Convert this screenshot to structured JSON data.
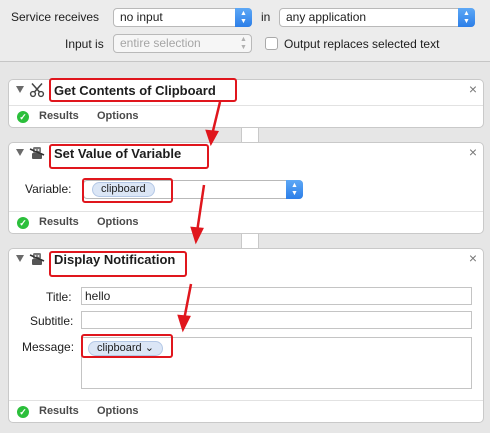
{
  "header": {
    "service_receives_label": "Service receives",
    "service_receives_value": "no input",
    "in_label": "in",
    "application_value": "any application",
    "input_is_label": "Input is",
    "input_is_value": "entire selection",
    "output_replaces_label": "Output replaces selected text",
    "output_replaces_checked": false
  },
  "actions": [
    {
      "title": "Get Contents of Clipboard",
      "icon": "scissors-icon",
      "footer": {
        "results": "Results",
        "options": "Options"
      }
    },
    {
      "title": "Set Value of Variable",
      "icon": "automator-robot-icon",
      "variable_label": "Variable:",
      "variable_token": "clipboard",
      "footer": {
        "results": "Results",
        "options": "Options"
      }
    },
    {
      "title": "Display Notification",
      "icon": "automator-robot-icon",
      "title_label": "Title:",
      "title_value": "hello",
      "subtitle_label": "Subtitle:",
      "subtitle_value": "",
      "message_label": "Message:",
      "message_token": "clipboard ⌄",
      "footer": {
        "results": "Results",
        "options": "Options"
      }
    }
  ],
  "colors": {
    "annotation_red": "#e0161d",
    "accent_blue": "#2c7ee8",
    "ok_green": "#2bbf3b"
  }
}
